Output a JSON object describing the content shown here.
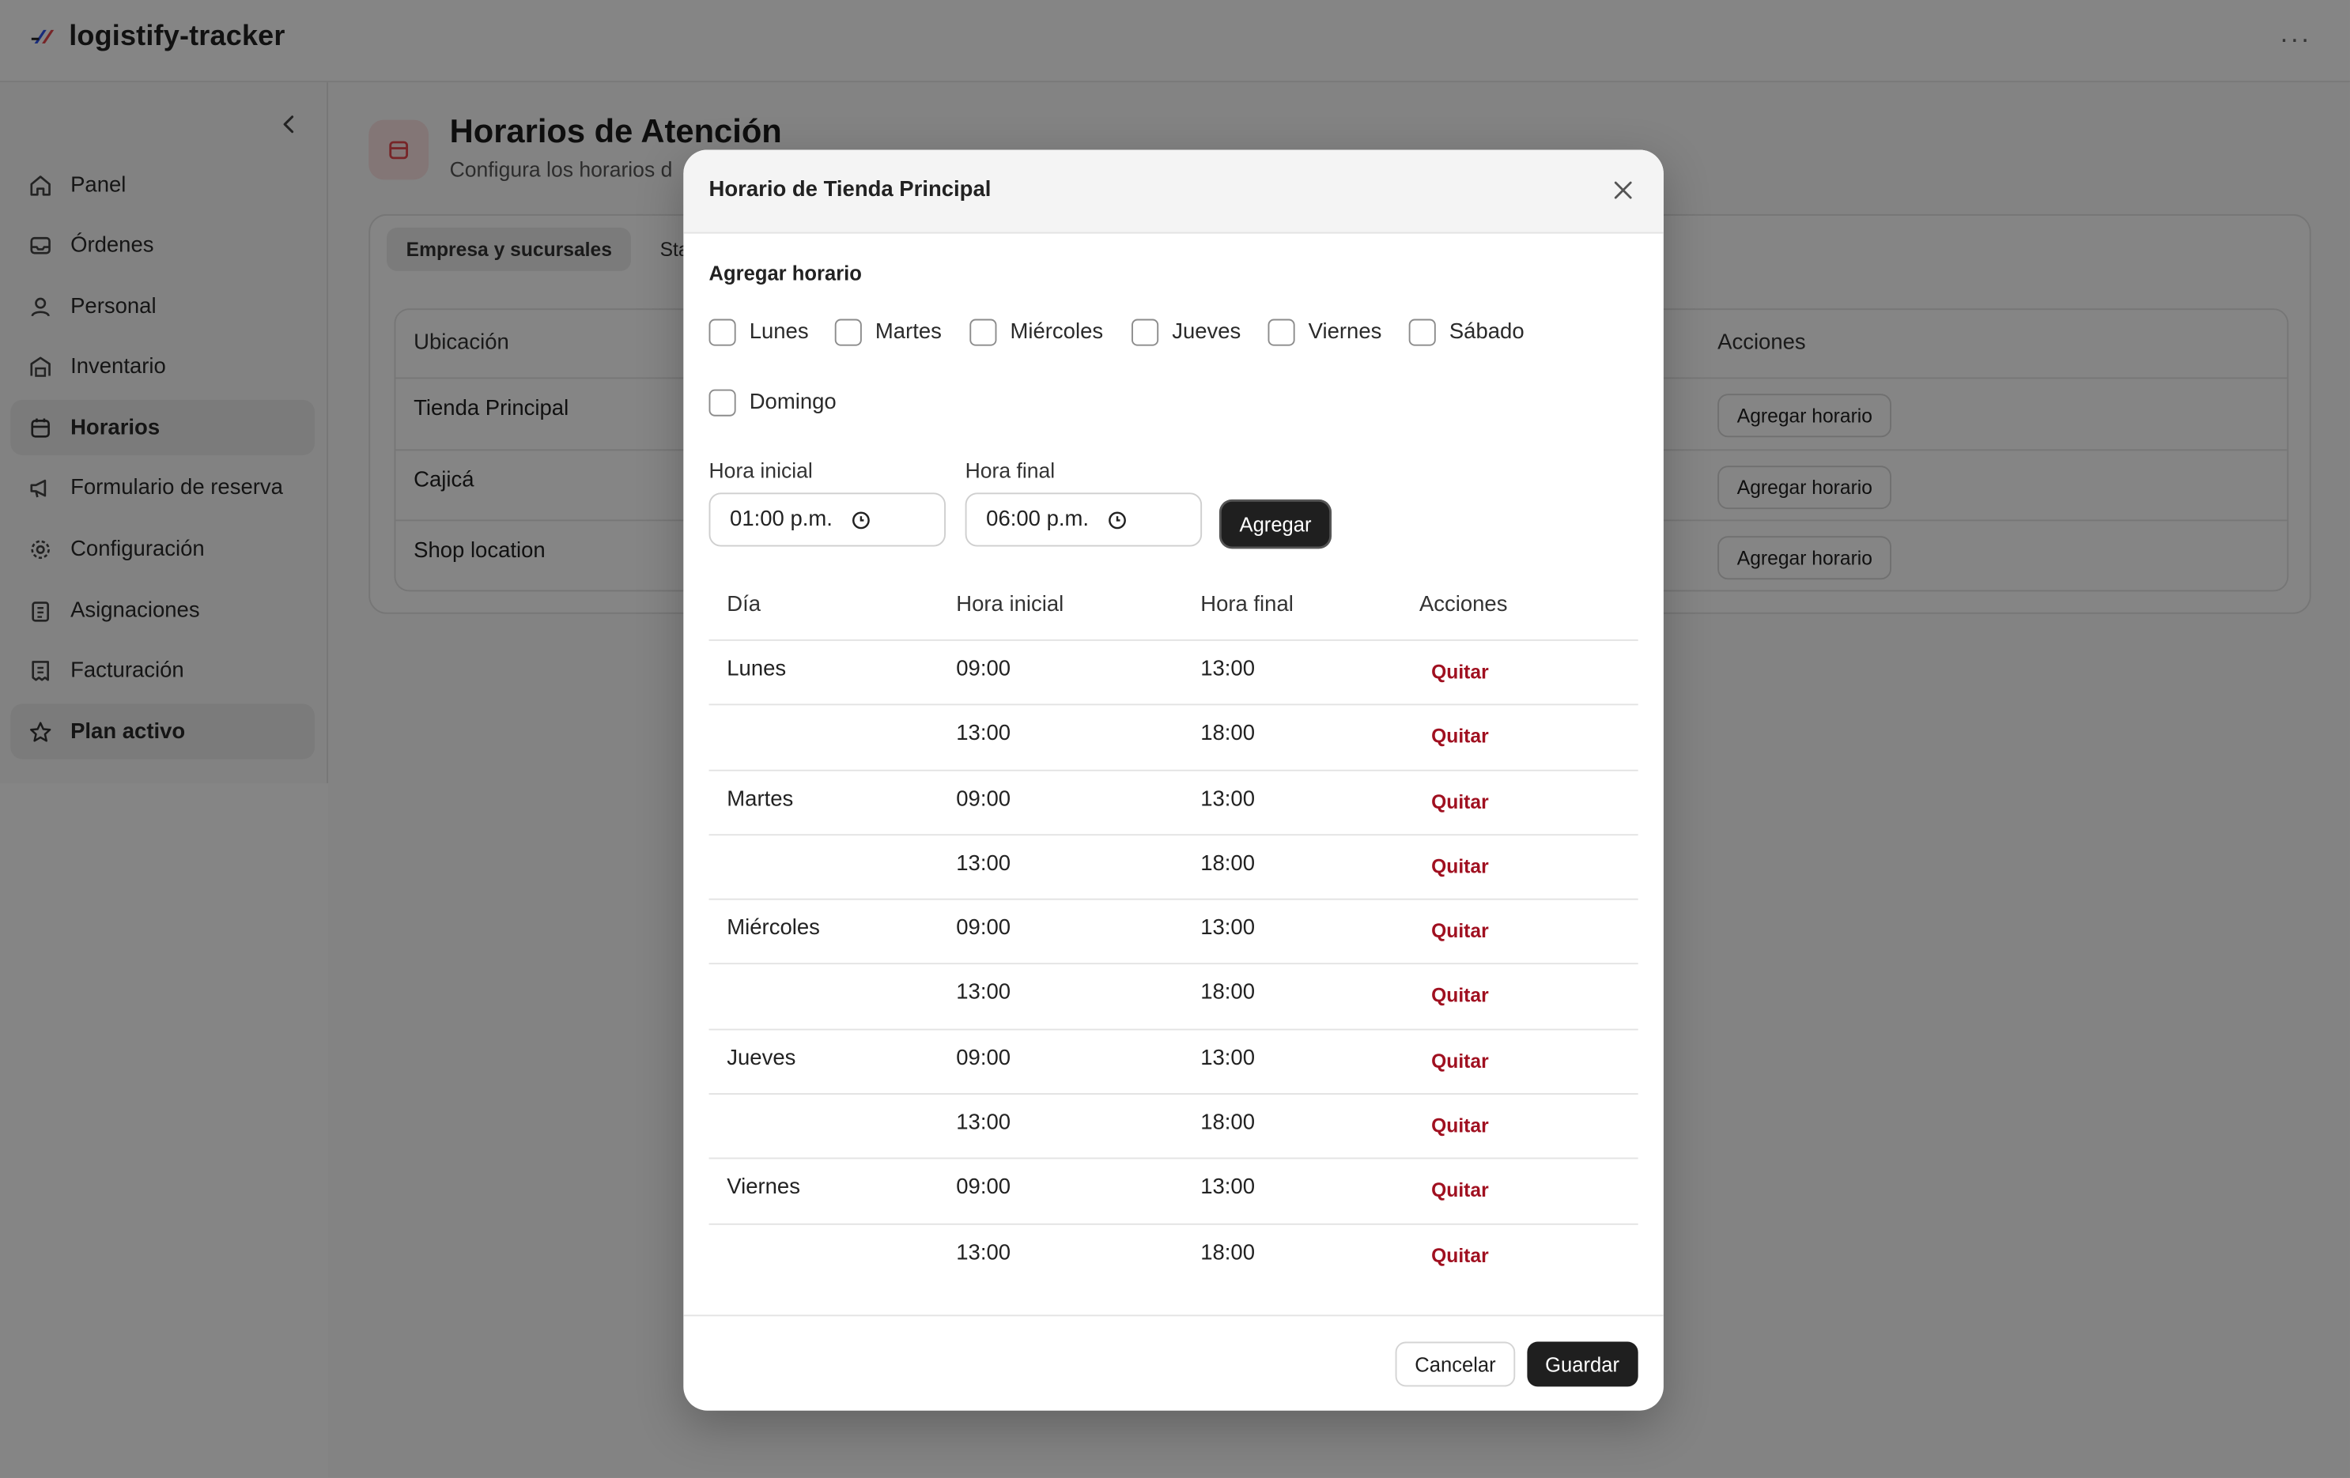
{
  "app": {
    "name": "logistify-tracker",
    "more_icon": "ellipsis-icon"
  },
  "sidebar": {
    "collapse_icon": "chevron-left-icon",
    "items": [
      {
        "label": "Panel",
        "icon": "home-icon",
        "active": false
      },
      {
        "label": "Órdenes",
        "icon": "inbox-icon",
        "active": false
      },
      {
        "label": "Personal",
        "icon": "user-icon",
        "active": false
      },
      {
        "label": "Inventario",
        "icon": "warehouse-icon",
        "active": false
      },
      {
        "label": "Horarios",
        "icon": "calendar-icon",
        "active": true
      },
      {
        "label": "Formulario de reserva",
        "icon": "megaphone-icon",
        "active": false
      },
      {
        "label": "Configuración",
        "icon": "gear-icon",
        "active": false
      },
      {
        "label": "Asignaciones",
        "icon": "clipboard-icon",
        "active": false
      },
      {
        "label": "Facturación",
        "icon": "receipt-icon",
        "active": false
      },
      {
        "label": "Plan activo",
        "icon": "star-icon",
        "active": true
      }
    ]
  },
  "page": {
    "title": "Horarios de Atención",
    "subtitle": "Configura los horarios d",
    "tabs": [
      {
        "label": "Empresa y sucursales"
      },
      {
        "label": "Stat"
      }
    ],
    "locations": {
      "headers": {
        "ubicacion": "Ubicación",
        "acciones": "Acciones"
      },
      "action_label": "Agregar horario",
      "rows": [
        "Tienda Principal",
        "Cajicá",
        "Shop location"
      ]
    }
  },
  "modal": {
    "title": "Horario de Tienda Principal",
    "section_title": "Agregar horario",
    "days": [
      "Lunes",
      "Martes",
      "Miércoles",
      "Jueves",
      "Viernes",
      "Sábado",
      "Domingo"
    ],
    "start_label": "Hora inicial",
    "start_value": "01:00  p.m.",
    "end_label": "Hora final",
    "end_value": "06:00  p.m.",
    "add_button": "Agregar",
    "table": {
      "headers": {
        "dia": "Día",
        "inicial": "Hora inicial",
        "final": "Hora final",
        "acciones": "Acciones"
      },
      "remove_label": "Quitar",
      "rows": [
        {
          "dia": "Lunes",
          "inicial": "09:00",
          "final": "13:00"
        },
        {
          "dia": "",
          "inicial": "13:00",
          "final": "18:00"
        },
        {
          "dia": "Martes",
          "inicial": "09:00",
          "final": "13:00"
        },
        {
          "dia": "",
          "inicial": "13:00",
          "final": "18:00"
        },
        {
          "dia": "Miércoles",
          "inicial": "09:00",
          "final": "13:00"
        },
        {
          "dia": "",
          "inicial": "13:00",
          "final": "18:00"
        },
        {
          "dia": "Jueves",
          "inicial": "09:00",
          "final": "13:00"
        },
        {
          "dia": "",
          "inicial": "13:00",
          "final": "18:00"
        },
        {
          "dia": "Viernes",
          "inicial": "09:00",
          "final": "13:00"
        },
        {
          "dia": "",
          "inicial": "13:00",
          "final": "18:00"
        }
      ]
    },
    "cancel_button": "Cancelar",
    "save_button": "Guardar"
  }
}
